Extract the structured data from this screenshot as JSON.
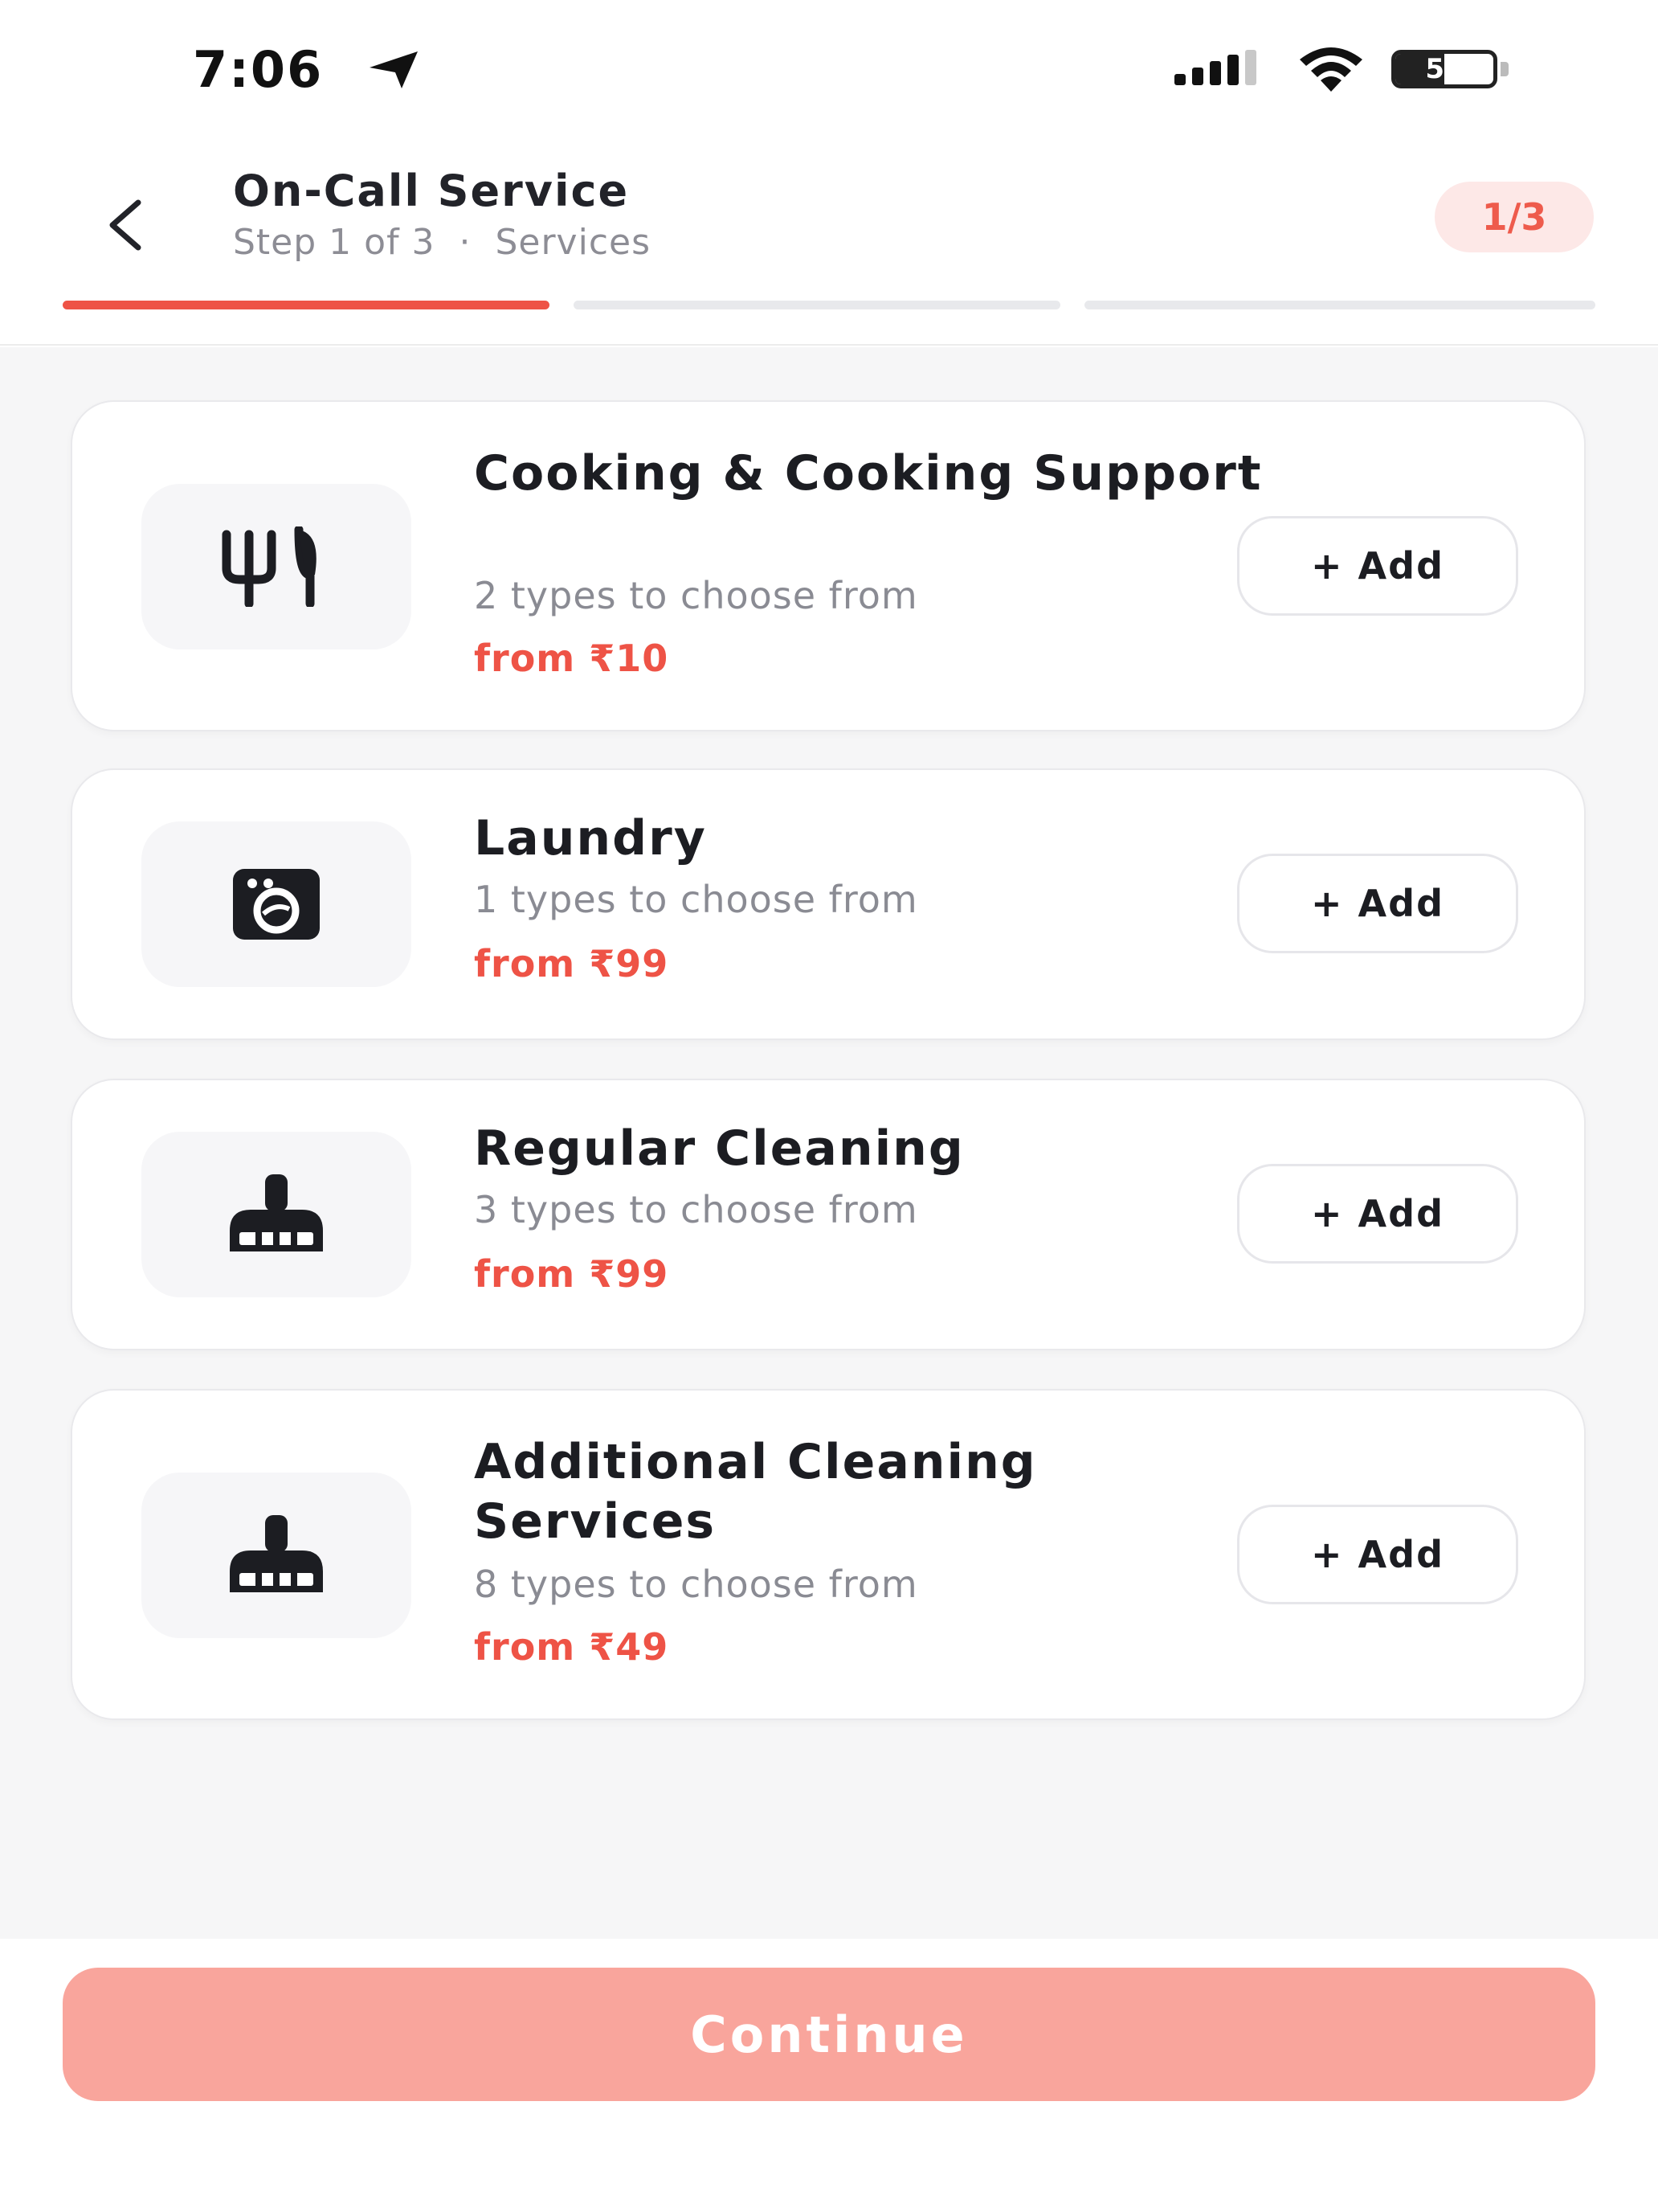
{
  "status_bar": {
    "time": "7:06",
    "battery": "50",
    "battery_level": 0.5
  },
  "header": {
    "title": "On-Call Service",
    "subtitle": "Step 1 of 3  ·  Services",
    "step_badge": "1/3",
    "progress": {
      "current_step": 1,
      "total_steps": 3
    }
  },
  "services": [
    {
      "title": "Cooking & Cooking Support",
      "types": "2 types to choose from",
      "price": "from ₹10",
      "icon": "cutlery-icon",
      "add_label": "+ Add"
    },
    {
      "title": "Laundry",
      "types": "1 types to choose from",
      "price": "from ₹99",
      "icon": "washing-machine-icon",
      "add_label": "+ Add"
    },
    {
      "title": "Regular  Cleaning",
      "types": "3 types to choose from",
      "price": "from ₹99",
      "icon": "broom-icon",
      "add_label": "+ Add"
    },
    {
      "title": "Additional Cleaning Services",
      "types": "8 types to choose from",
      "price": "from ₹49",
      "icon": "broom-icon",
      "add_label": "+ Add"
    }
  ],
  "footer": {
    "continue_label": "Continue"
  },
  "colors": {
    "accent": "#ee5346",
    "accent_light": "#f9a59c",
    "badge_bg": "#fde8e7",
    "text_dark": "#1c1d22",
    "text_muted": "#8a8b93"
  }
}
